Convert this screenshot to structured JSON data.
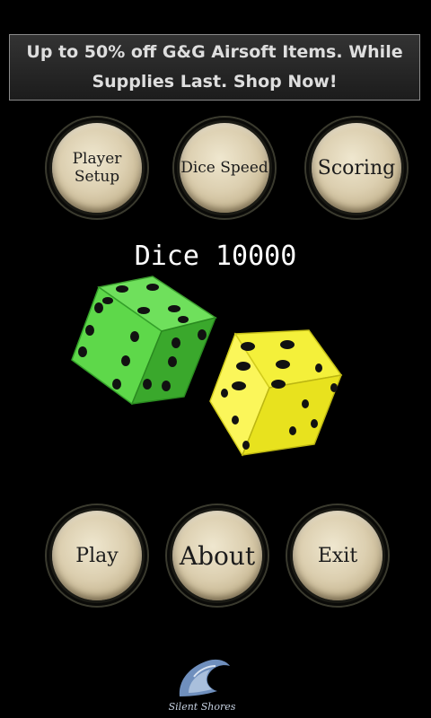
{
  "ad": {
    "text": "Up to 50% off G&G Airsoft Items. While Supplies Last. Shop Now!"
  },
  "top_buttons": {
    "player_setup": "Player Setup",
    "dice_speed": "Dice Speed",
    "scoring": "Scoring"
  },
  "title": "Dice 10000",
  "dice": [
    {
      "color": "green",
      "fill": "#46c83a",
      "visible_faces": [
        6,
        4,
        5
      ]
    },
    {
      "color": "yellow",
      "fill": "#f2ee2a",
      "visible_faces": [
        6,
        4,
        5
      ]
    }
  ],
  "bottom_buttons": {
    "play": "Play",
    "about": "About",
    "exit": "Exit"
  },
  "logo": {
    "name": "Silent Shores"
  },
  "colors": {
    "background": "#000000",
    "button_face": "#dccfb0",
    "ad_text": "#dedede"
  }
}
